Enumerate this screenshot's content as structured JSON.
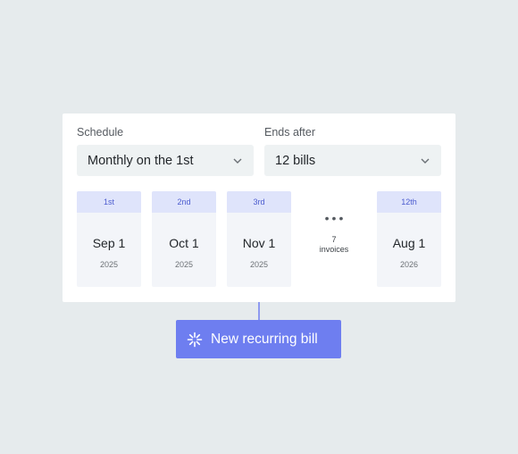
{
  "schedule": {
    "label": "Schedule",
    "value": "Monthly on the 1st",
    "icon": "chevron-down-icon"
  },
  "ends_after": {
    "label": "Ends after",
    "value": "12 bills",
    "icon": "chevron-down-icon"
  },
  "bills": [
    {
      "ordinal": "1st",
      "date": "Sep 1",
      "year": "2025"
    },
    {
      "ordinal": "2nd",
      "date": "Oct 1",
      "year": "2025"
    },
    {
      "ordinal": "3rd",
      "date": "Nov 1",
      "year": "2025"
    },
    {
      "ordinal": "12th",
      "date": "Aug 1",
      "year": "2026"
    }
  ],
  "gap": {
    "dots": "•••",
    "count": "7",
    "unit": "invoices"
  },
  "cta": {
    "label": "New recurring bill",
    "icon": "sparkle-icon"
  },
  "colors": {
    "background": "#e6ebed",
    "accent": "#6e7ef0",
    "card_header": "#dfe4fb",
    "card_header_text": "#4c5ccf"
  }
}
